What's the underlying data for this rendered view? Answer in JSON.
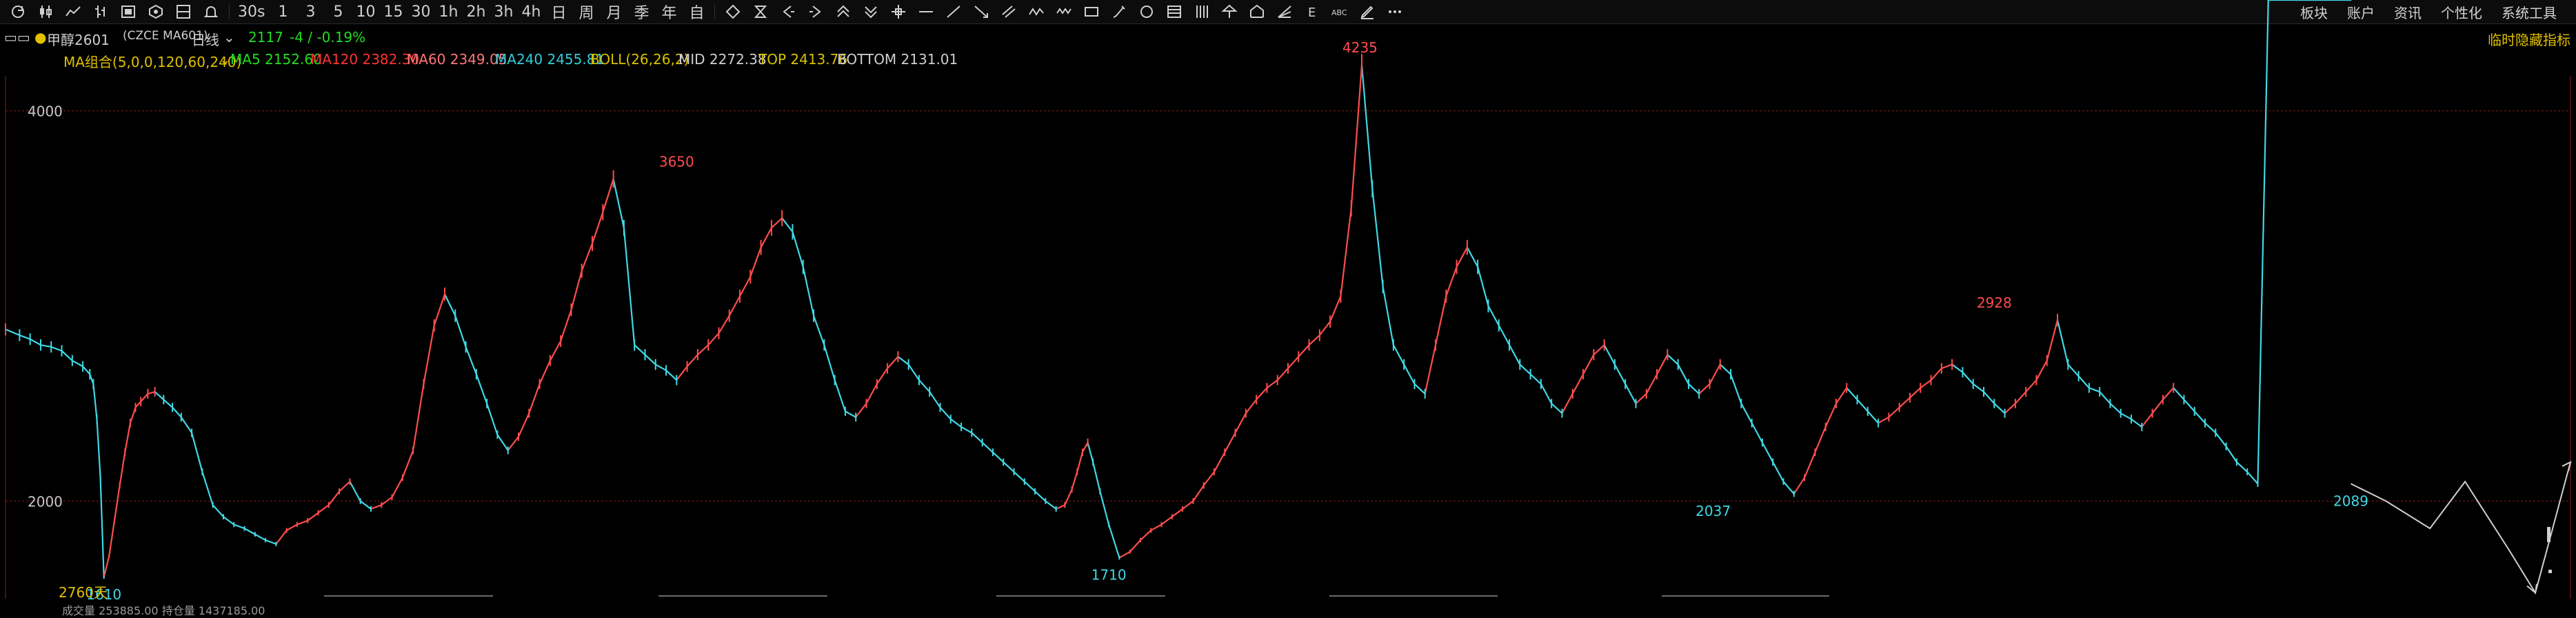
{
  "toolbar": {
    "tools": [
      {
        "id": "refresh",
        "icon": "refresh-icon"
      },
      {
        "id": "kline",
        "icon": "candlestick-icon"
      },
      {
        "id": "line",
        "icon": "line-chart-icon"
      },
      {
        "id": "bars",
        "icon": "ohlc-bars-icon"
      },
      {
        "id": "heikin",
        "icon": "heikin-ashi-icon"
      },
      {
        "id": "box",
        "icon": "box-chart-icon"
      },
      {
        "id": "renko",
        "icon": "renko-icon"
      },
      {
        "id": "alert",
        "icon": "bell-icon"
      }
    ],
    "periods": [
      "30s",
      "1",
      "3",
      "5",
      "10",
      "15",
      "30",
      "1h",
      "2h",
      "3h",
      "4h",
      "日",
      "周",
      "月",
      "季",
      "年",
      "自"
    ],
    "draw_tools": [
      "diamond-icon",
      "hourglass-icon",
      "arrow-left-icon",
      "arrow-right-icon",
      "chevron-up-icon",
      "chevron-down-icon",
      "crosshair-icon",
      "horizontal-line-icon",
      "trend-line-icon",
      "ray-icon",
      "parallel-lines-icon",
      "zigzag-icon",
      "wave-icon",
      "rectangle-icon",
      "brush-icon",
      "circle-icon",
      "gann-icon",
      "fib-lines-icon",
      "pitchfork-icon",
      "house-icon",
      "fib-fan-icon",
      "text-e-icon",
      "abc-text-icon",
      "pen-icon",
      "more-icon"
    ],
    "right_menu": [
      "板块",
      "账户",
      "资讯",
      "个性化",
      "系统工具"
    ]
  },
  "symbol": {
    "name": "甲醇2601",
    "exchange": "(CZCE MA601)",
    "period": "日线",
    "price": "2117",
    "change": "-4 / -0.19%",
    "right_label": "临时隐藏指标",
    "day_count": "2760天"
  },
  "indicator_bar": {
    "ma_label": "MA组合(5,0,0,120,60,240)",
    "ma5": "MA5 2152.60",
    "ma120": "MA120 2382.30",
    "ma60": "MA60 2349.05",
    "ma240": "MA240 2455.81",
    "boll": "BOLL(26,26,2)",
    "mid": "MID 2272.38",
    "top": "TOP 2413.76",
    "bottom": "BOTTOM 2131.01"
  },
  "bottom_fragment": "成交量 253885.00  持仓量 1437185.00",
  "colors": {
    "background": "#000000",
    "up": "#ff4d4d",
    "down": "#3fd9e6",
    "grid": "#5a1414",
    "ma5": "#22dd22",
    "ma120": "#ff3333",
    "ma60": "#ff7777",
    "ma240": "#33ccdd",
    "mid": "#cfcfcf",
    "top": "#d9c200",
    "bottom": "#cfcfcf",
    "ma_label": "#e0c000",
    "price": "#22dd22",
    "projection": "#cfcfcf"
  },
  "chart_data": {
    "type": "line",
    "ylim": [
      1500,
      4200
    ],
    "yticks": [
      2000,
      4000
    ],
    "x": [
      0,
      16,
      28,
      40,
      52,
      64,
      76,
      88,
      96,
      100,
      104,
      108,
      112,
      118,
      124,
      130,
      136,
      142,
      148,
      154,
      162,
      170,
      180,
      190,
      200,
      212,
      224,
      236,
      248,
      260,
      272,
      284,
      296,
      308,
      320,
      332,
      344,
      356,
      368,
      380,
      392,
      404,
      416,
      428,
      440,
      452,
      464,
      476,
      488,
      500,
      512,
      524,
      536,
      548,
      560,
      572,
      584,
      596,
      608,
      620,
      632,
      644,
      656,
      668,
      680,
      692,
      704,
      716,
      728,
      740,
      752,
      764,
      776,
      788,
      800,
      812,
      824,
      836,
      848,
      860,
      872,
      884,
      896,
      908,
      920,
      932,
      944,
      956,
      968,
      980,
      992,
      1004,
      1016,
      1028,
      1040,
      1052,
      1064,
      1076,
      1088,
      1100,
      1112,
      1124,
      1136,
      1148,
      1160,
      1172,
      1184,
      1196,
      1206,
      1214,
      1220,
      1226,
      1232,
      1238,
      1246,
      1256,
      1268,
      1280,
      1292,
      1304,
      1316,
      1328,
      1340,
      1352,
      1364,
      1376,
      1388,
      1400,
      1412,
      1424,
      1436,
      1448,
      1460,
      1472,
      1484,
      1496,
      1508,
      1520,
      1532,
      1544,
      1556,
      1568,
      1580,
      1592,
      1604,
      1616,
      1628,
      1640,
      1652,
      1664,
      1676,
      1688,
      1700,
      1712,
      1724,
      1736,
      1748,
      1760,
      1772,
      1784,
      1796,
      1808,
      1820,
      1832,
      1844,
      1856,
      1868,
      1880,
      1892,
      1904,
      1916,
      1928,
      1940,
      1952,
      1964,
      1976,
      1988,
      2000,
      2012,
      2024,
      2036,
      2048,
      2060,
      2072,
      2084,
      2096,
      2108,
      2120,
      2132,
      2144,
      2156,
      2168,
      2180,
      2192,
      2204,
      2216,
      2228,
      2240,
      2252,
      2264,
      2276,
      2288,
      2300,
      2312,
      2324,
      2336,
      2348,
      2360,
      2372,
      2384,
      2396,
      2408,
      2420,
      2432,
      2444,
      2456,
      2468,
      2480,
      2492,
      2504,
      2516,
      2528,
      2540,
      2552,
      2564,
      2576,
      2588,
      2600,
      2612,
      2624,
      2636,
      2648,
      2660,
      2670
    ],
    "series": [
      {
        "values": [
          2880,
          2850,
          2830,
          2800,
          2790,
          2770,
          2720,
          2690,
          2650,
          2600,
          2420,
          2120,
          1610,
          1720,
          1900,
          2080,
          2250,
          2400,
          2480,
          2510,
          2550,
          2560,
          2520,
          2480,
          2430,
          2350,
          2150,
          1980,
          1920,
          1880,
          1860,
          1830,
          1800,
          1780,
          1850,
          1880,
          1900,
          1940,
          1980,
          2050,
          2100,
          2000,
          1960,
          1980,
          2020,
          2120,
          2260,
          2600,
          2900,
          3060,
          2950,
          2790,
          2650,
          2500,
          2340,
          2260,
          2330,
          2450,
          2600,
          2720,
          2820,
          2980,
          3180,
          3320,
          3480,
          3650,
          3400,
          2800,
          2750,
          2700,
          2670,
          2620,
          2690,
          2750,
          2800,
          2860,
          2950,
          3050,
          3150,
          3300,
          3400,
          3450,
          3380,
          3200,
          2950,
          2800,
          2620,
          2460,
          2430,
          2500,
          2600,
          2680,
          2740,
          2700,
          2620,
          2560,
          2480,
          2420,
          2380,
          2350,
          2300,
          2250,
          2200,
          2150,
          2100,
          2050,
          2000,
          1960,
          1980,
          2060,
          2150,
          2250,
          2300,
          2200,
          2050,
          1880,
          1710,
          1740,
          1800,
          1850,
          1880,
          1920,
          1960,
          2000,
          2080,
          2150,
          2250,
          2350,
          2450,
          2520,
          2580,
          2620,
          2680,
          2740,
          2800,
          2850,
          2920,
          3050,
          3500,
          4235,
          3600,
          3100,
          2800,
          2700,
          2600,
          2550,
          2800,
          3050,
          3200,
          3300,
          3200,
          3000,
          2900,
          2800,
          2700,
          2650,
          2600,
          2500,
          2450,
          2550,
          2650,
          2750,
          2800,
          2700,
          2600,
          2500,
          2550,
          2650,
          2750,
          2700,
          2600,
          2550,
          2600,
          2700,
          2650,
          2500,
          2400,
          2300,
          2200,
          2100,
          2037,
          2120,
          2250,
          2380,
          2500,
          2580,
          2520,
          2460,
          2400,
          2430,
          2480,
          2530,
          2580,
          2620,
          2680,
          2700,
          2660,
          2600,
          2560,
          2500,
          2450,
          2500,
          2560,
          2620,
          2720,
          2928,
          2700,
          2640,
          2580,
          2560,
          2500,
          2450,
          2420,
          2380,
          2450,
          2520,
          2580,
          2520,
          2460,
          2400,
          2350,
          2280,
          2200,
          2150,
          2089
        ]
      },
      {
        "name": "projection",
        "x": [
          2670,
          2710,
          2760,
          2800,
          2850,
          2880,
          2920
        ],
        "values": [
          2089,
          2000,
          1860,
          2100,
          1750,
          1530,
          2200
        ]
      }
    ],
    "annotations": [
      {
        "label": "1610",
        "x": 112,
        "y": 1610,
        "kind": "low"
      },
      {
        "label": "3650",
        "x": 764,
        "y": 3650,
        "kind": "high"
      },
      {
        "label": "1710",
        "x": 1256,
        "y": 1710,
        "kind": "low"
      },
      {
        "label": "4235",
        "x": 1542,
        "y": 4235,
        "kind": "high"
      },
      {
        "label": "2037",
        "x": 1944,
        "y": 2037,
        "kind": "low"
      },
      {
        "label": "2928",
        "x": 2264,
        "y": 2928,
        "kind": "high"
      },
      {
        "label": "2089",
        "x": 2670,
        "y": 2089,
        "kind": "low"
      }
    ]
  }
}
